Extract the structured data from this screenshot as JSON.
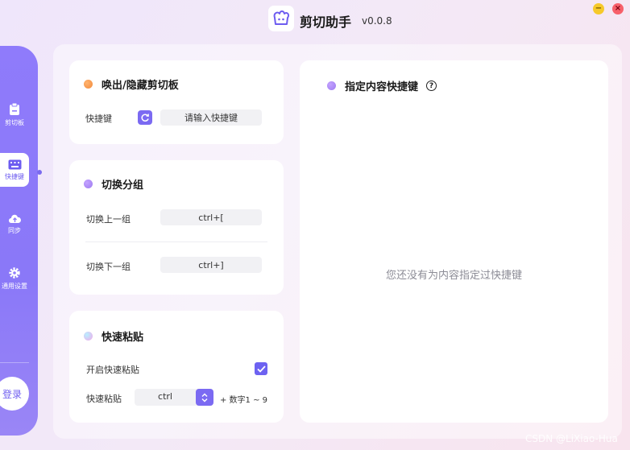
{
  "app": {
    "title": "剪切助手",
    "version": "v0.0.8",
    "minimize_icon": "minimize-icon",
    "close_icon": "close-icon"
  },
  "sidebar": {
    "items": [
      {
        "label": "剪切板",
        "icon": "clipboard-icon",
        "active": false
      },
      {
        "label": "快捷键",
        "icon": "keyboard-icon",
        "active": true
      },
      {
        "label": "同步",
        "icon": "cloud-sync-icon",
        "active": false
      },
      {
        "label": "通用设置",
        "icon": "gear-icon",
        "active": false
      }
    ],
    "login_label": "登录"
  },
  "card_toggle": {
    "title": "唤出/隐藏剪切板",
    "shortcut_label": "快捷键",
    "shortcut_placeholder": "请输入快捷键"
  },
  "card_group": {
    "title": "切换分组",
    "prev_label": "切换上一组",
    "prev_value": "ctrl+[",
    "next_label": "切换下一组",
    "next_value": "ctrl+]"
  },
  "card_paste": {
    "title": "快速粘贴",
    "enable_label": "开启快速粘贴",
    "enable_checked": true,
    "paste_label": "快速粘贴",
    "modifier_value": "ctrl",
    "suffix": "+ 数字1 ~ 9"
  },
  "content_shortcuts": {
    "title": "指定内容快捷键",
    "empty_message": "您还没有为内容指定过快捷键"
  },
  "colors": {
    "accent": "#7b6af2",
    "sidebar": "#8f7bfb"
  },
  "watermark": "CSDN @LiXiao-Hua"
}
